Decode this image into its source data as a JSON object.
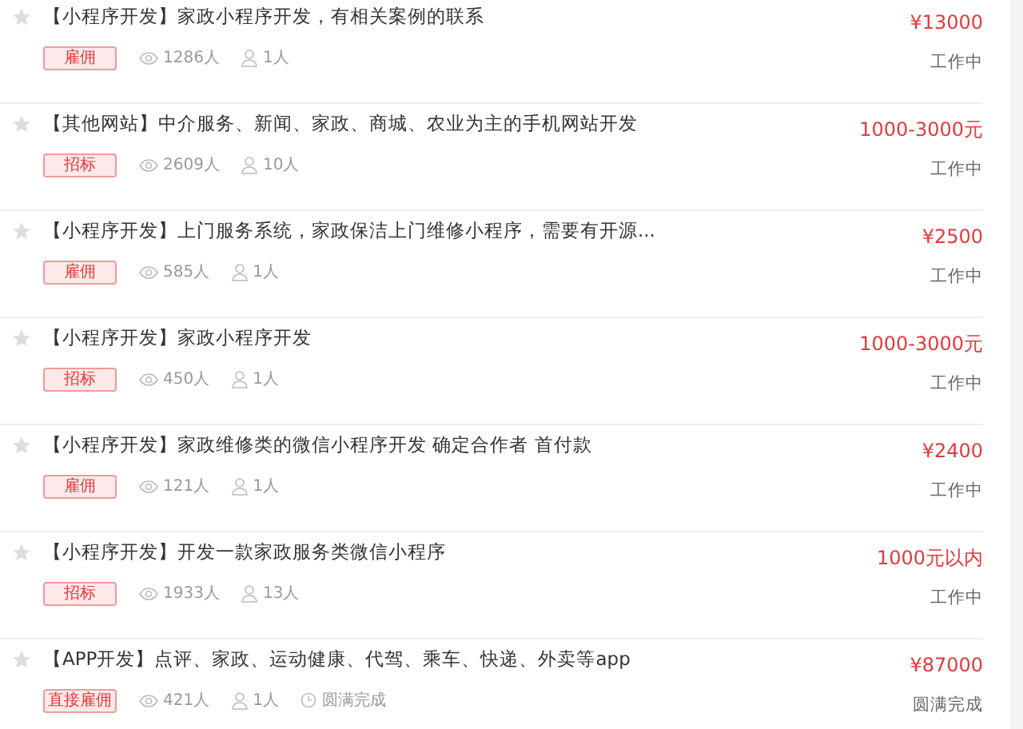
{
  "projects": [
    {
      "title": "【小程序开发】家政小程序开发，有相关案例的联系",
      "starred": false,
      "tag": "雇佣",
      "views": "1286人",
      "bidders": "1人",
      "price": "¥13000",
      "status": "工作中"
    },
    {
      "title": "【其他网站】中介服务、新闻、家政、商城、农业为主的手机网站开发",
      "starred": false,
      "tag": "招标",
      "views": "2609人",
      "bidders": "10人",
      "price": "1000-3000元",
      "status": "工作中"
    },
    {
      "title": "【小程序开发】上门服务系统，家政保洁上门维修小程序，需要有开源...",
      "starred": false,
      "tag": "雇佣",
      "views": "585人",
      "bidders": "1人",
      "price": "¥2500",
      "status": "工作中"
    },
    {
      "title": "【小程序开发】家政小程序开发",
      "starred": false,
      "tag": "招标",
      "views": "450人",
      "bidders": "1人",
      "price": "1000-3000元",
      "status": "工作中"
    },
    {
      "title": "【小程序开发】家政维修类的微信小程序开发 确定合作者 首付款",
      "starred": false,
      "tag": "雇佣",
      "views": "121人",
      "bidders": "1人",
      "price": "¥2400",
      "status": "工作中"
    },
    {
      "title": "【小程序开发】开发一款家政服务类微信小程序",
      "starred": false,
      "tag": "招标",
      "views": "1933人",
      "bidders": "13人",
      "price": "1000元以内",
      "status": "工作中"
    },
    {
      "title": "【APP开发】点评、家政、运动健康、代驾、乘车、快递、外卖等app",
      "starred": false,
      "tag": "直接雇佣",
      "views": "421人",
      "bidders": "1人",
      "finished": "圆满完成",
      "price": "¥87000",
      "status": "圆满完成"
    }
  ]
}
